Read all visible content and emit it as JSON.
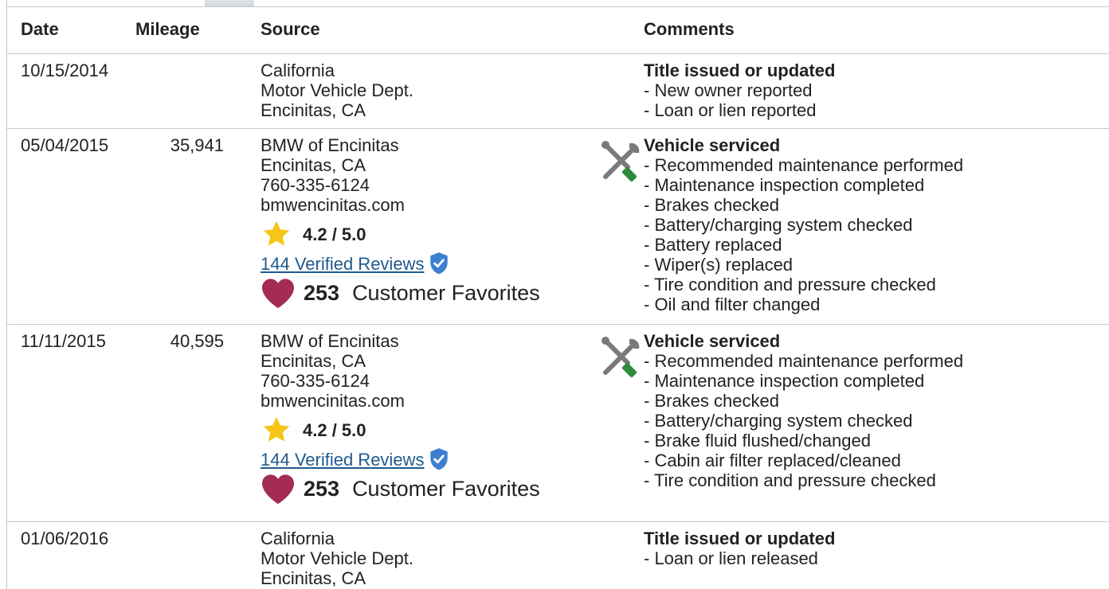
{
  "columns": {
    "date": "Date",
    "mileage": "Mileage",
    "source": "Source",
    "comments": "Comments"
  },
  "rows": [
    {
      "date": "10/15/2014",
      "mileage": "",
      "source": [
        "California",
        "Motor Vehicle Dept.",
        "Encinitas, CA"
      ],
      "comment_title": "Title issued or updated",
      "comments": [
        "- New owner reported",
        "- Loan or lien reported"
      ]
    },
    {
      "date": "05/04/2015",
      "mileage": "35,941",
      "source": [
        "BMW of Encinitas",
        "Encinitas, CA",
        "760-335-6124",
        "bmwencinitas.com"
      ],
      "rating": "4.2 / 5.0",
      "reviews": "144 Verified Reviews",
      "favorites_count": "253",
      "favorites_label": "Customer Favorites",
      "comment_title": "Vehicle serviced",
      "comments": [
        "- Recommended maintenance performed",
        "- Maintenance inspection completed",
        "- Brakes checked",
        "- Battery/charging system checked",
        "- Battery replaced",
        "- Wiper(s) replaced",
        "- Tire condition and pressure checked",
        "- Oil and filter changed"
      ]
    },
    {
      "date": "11/11/2015",
      "mileage": "40,595",
      "source": [
        "BMW of Encinitas",
        "Encinitas, CA",
        "760-335-6124",
        "bmwencinitas.com"
      ],
      "rating": "4.2 / 5.0",
      "reviews": "144 Verified Reviews",
      "favorites_count": "253",
      "favorites_label": "Customer Favorites",
      "comment_title": "Vehicle serviced",
      "comments": [
        "- Recommended maintenance performed",
        "- Maintenance inspection completed",
        "- Brakes checked",
        "- Battery/charging system checked",
        "- Brake fluid flushed/changed",
        "- Cabin air filter replaced/cleaned",
        "- Tire condition and pressure checked"
      ]
    },
    {
      "date": "01/06/2016",
      "mileage": "",
      "source": [
        "California",
        "Motor Vehicle Dept.",
        "Encinitas, CA"
      ],
      "comment_title": "Title issued or updated",
      "comments": [
        "- Loan or lien released"
      ]
    }
  ],
  "icons": {
    "service": "wrench-screwdriver-icon",
    "rating": "star-icon",
    "verified": "shield-check-icon",
    "favorite": "heart-icon"
  },
  "colors": {
    "link": "#1f5a8f",
    "star": "#f5c518",
    "heart": "#a32b54",
    "shield": "#3c7fd0",
    "tool_green": "#2e8b3d"
  }
}
